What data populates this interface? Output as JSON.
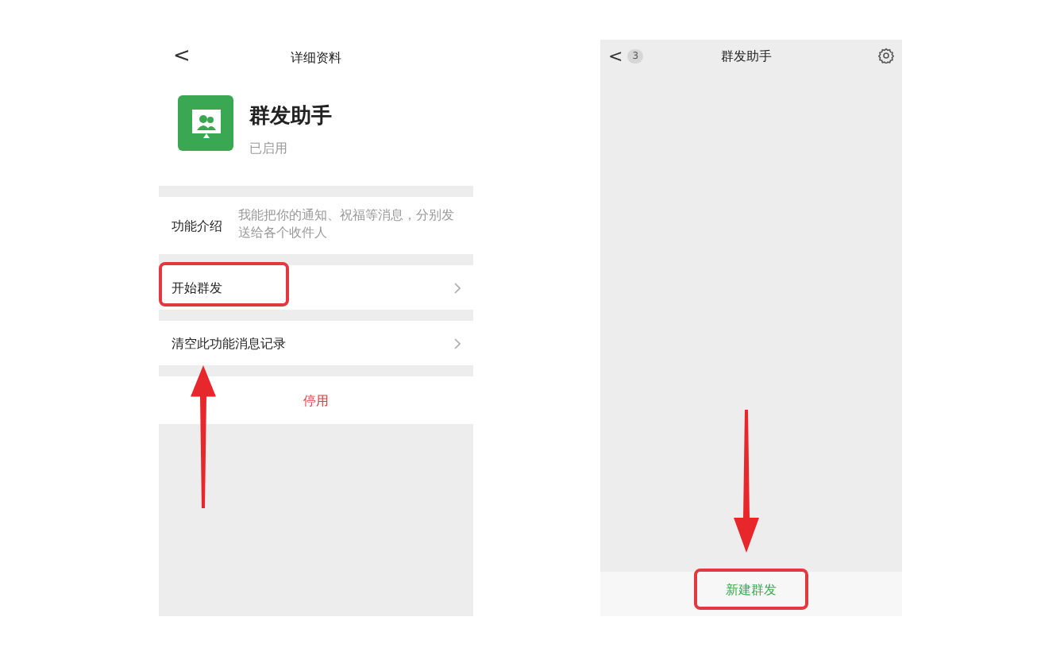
{
  "profile_screen": {
    "header": {
      "back": "<",
      "title": "详细资料"
    },
    "profile": {
      "name": "群发助手",
      "status": "已启用"
    },
    "rows": [
      {
        "kind": "intro",
        "label": "功能介绍",
        "value": "我能把你的通知、祝福等消息，分别发送给各个收件人",
        "highlighted": false
      },
      {
        "kind": "link",
        "label": "开始群发",
        "highlighted": true
      },
      {
        "kind": "link",
        "label": "清空此功能消息记录",
        "highlighted": false
      }
    ],
    "disable_button": "停用"
  },
  "chat_screen": {
    "header": {
      "back": "<",
      "badge": "3",
      "title": "群发助手"
    },
    "bottom_button": {
      "label": "新建群发",
      "highlighted": true
    }
  }
}
